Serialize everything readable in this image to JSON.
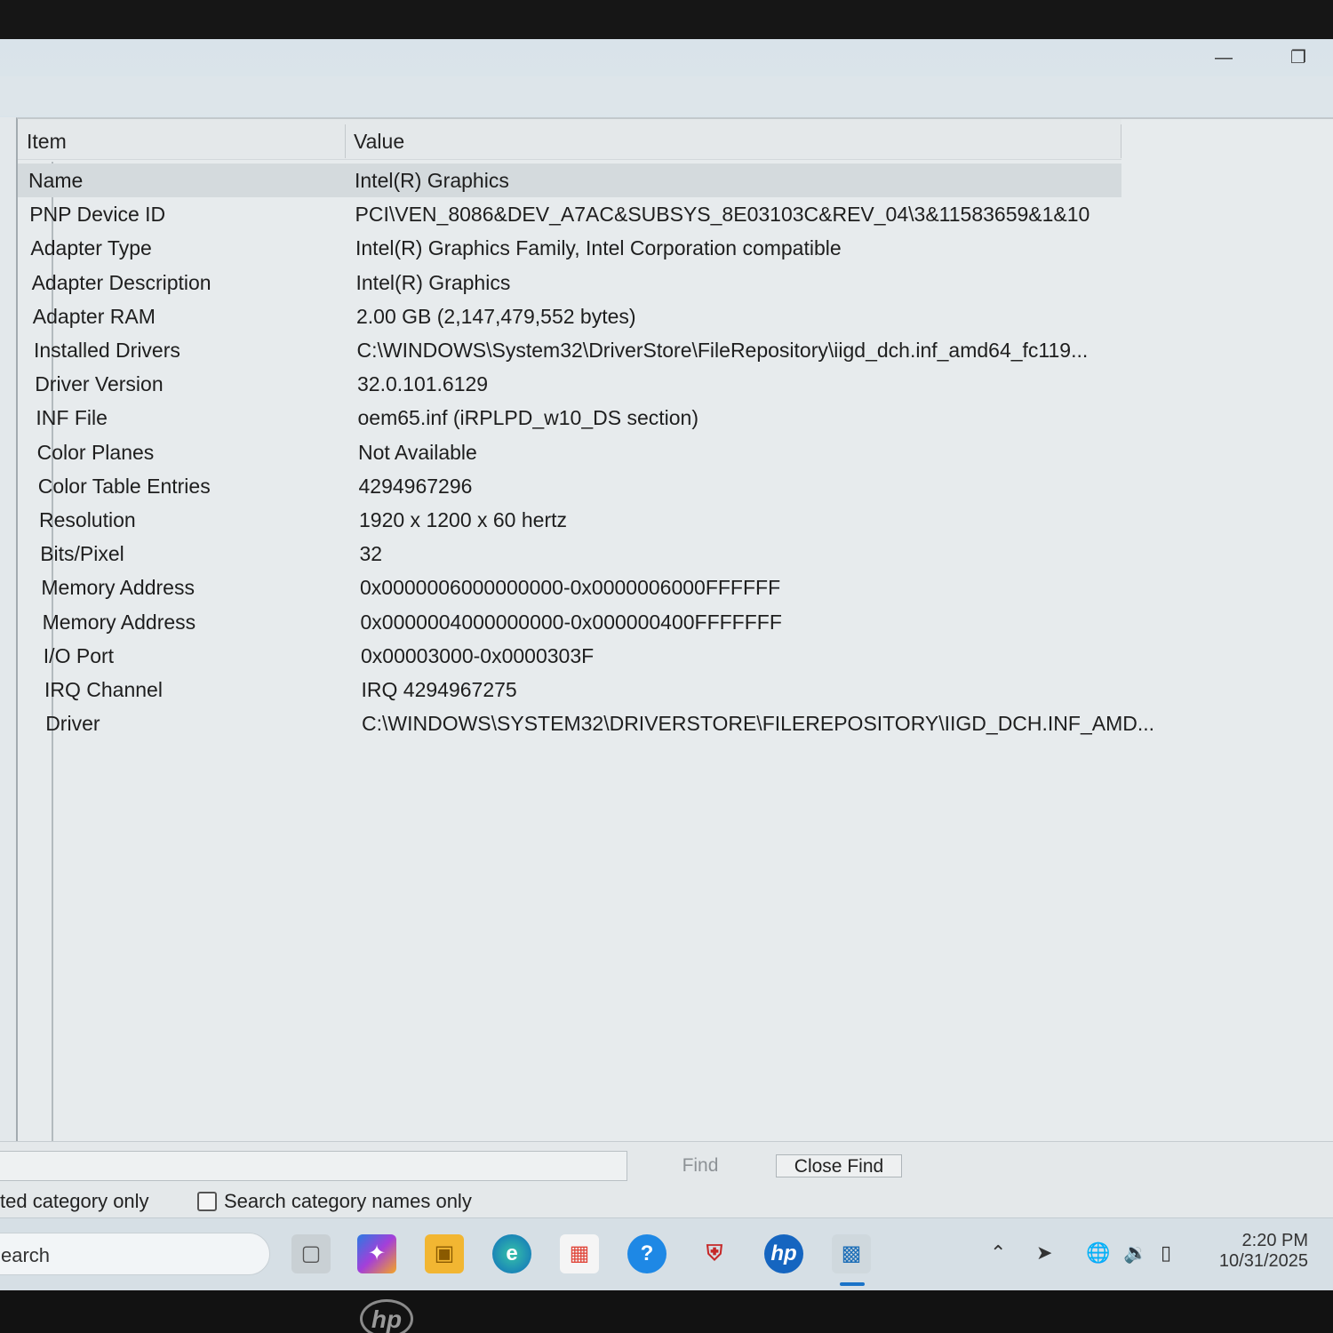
{
  "columns": {
    "item": "Item",
    "value": "Value"
  },
  "rows": [
    {
      "item": "Name",
      "value": "Intel(R) Graphics"
    },
    {
      "item": "PNP Device ID",
      "value": "PCI\\VEN_8086&DEV_A7AC&SUBSYS_8E03103C&REV_04\\3&11583659&1&10"
    },
    {
      "item": "Adapter Type",
      "value": "Intel(R) Graphics Family, Intel Corporation compatible"
    },
    {
      "item": "Adapter Description",
      "value": "Intel(R) Graphics"
    },
    {
      "item": "Adapter RAM",
      "value": "2.00 GB (2,147,479,552 bytes)"
    },
    {
      "item": "Installed Drivers",
      "value": "C:\\WINDOWS\\System32\\DriverStore\\FileRepository\\iigd_dch.inf_amd64_fc119..."
    },
    {
      "item": "Driver Version",
      "value": "32.0.101.6129"
    },
    {
      "item": "INF File",
      "value": "oem65.inf (iRPLPD_w10_DS section)"
    },
    {
      "item": "Color Planes",
      "value": "Not Available"
    },
    {
      "item": "Color Table Entries",
      "value": "4294967296"
    },
    {
      "item": "Resolution",
      "value": "1920 x 1200 x 60 hertz"
    },
    {
      "item": "Bits/Pixel",
      "value": "32"
    },
    {
      "item": "Memory Address",
      "value": "0x0000006000000000-0x0000006000FFFFFF"
    },
    {
      "item": "Memory Address",
      "value": "0x0000004000000000-0x000000400FFFFFFF"
    },
    {
      "item": "I/O Port",
      "value": "0x00003000-0x0000303F"
    },
    {
      "item": "IRQ Channel",
      "value": "IRQ 4294967275"
    },
    {
      "item": "Driver",
      "value": "C:\\WINDOWS\\SYSTEM32\\DRIVERSTORE\\FILEREPOSITORY\\IIGD_DCH.INF_AMD..."
    }
  ],
  "find_bar": {
    "find_label": "Find",
    "close_find_label": "Close Find",
    "selected_category_label": "ted category only",
    "category_names_label": "Search category names only"
  },
  "taskbar": {
    "search_placeholder": "earch",
    "time": "2:20 PM",
    "date": "10/31/2025"
  },
  "bezel": {
    "logo_text": "hp"
  }
}
